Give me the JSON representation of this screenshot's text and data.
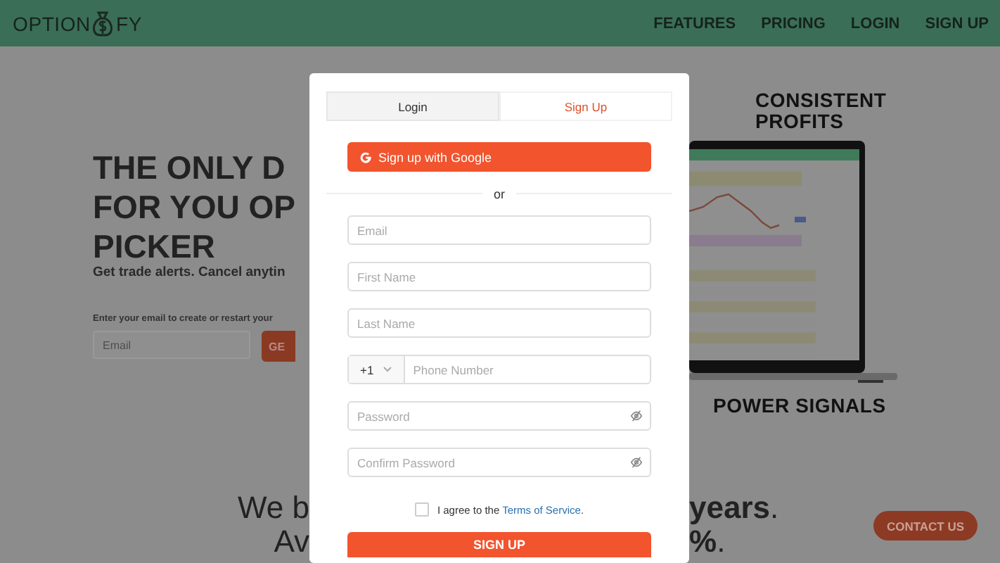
{
  "header": {
    "logo_left": "OPTION",
    "logo_right": "FY",
    "nav": [
      "FEATURES",
      "PRICING",
      "LOGIN",
      "SIGN UP"
    ]
  },
  "hero": {
    "headline": [
      "THE ONLY D",
      "FOR YOU OP",
      "PICKER"
    ],
    "subtitle": "Get trade alerts. Cancel anytin",
    "email_prompt": "Enter your email to create or restart your",
    "email_field": {
      "placeholder": "Email"
    },
    "button": "GE"
  },
  "promo": {
    "top": "CONSISTENT PROFITS",
    "bottom": "POWER SIGNALS"
  },
  "stats": [
    {
      "left": "We b",
      "right": "**years**."
    },
    {
      "left": "Av",
      "right": "**%**."
    }
  ],
  "contact_button": "CONTACT US",
  "modal": {
    "tabs": [
      {
        "label": "Login",
        "selected": false
      },
      {
        "label": "Sign Up",
        "selected": true
      }
    ],
    "google_button": "Sign up with Google",
    "divider": "or",
    "fields": [
      {
        "kind": "text",
        "placeholder": "Email"
      },
      {
        "kind": "text",
        "placeholder": "First Name"
      },
      {
        "kind": "text",
        "placeholder": "Last Name"
      },
      {
        "kind": "phone",
        "code": "+1",
        "placeholder": "Phone Number"
      },
      {
        "kind": "password",
        "placeholder": "Password"
      },
      {
        "kind": "password",
        "placeholder": "Confirm Password"
      }
    ],
    "terms": {
      "checked": false,
      "text": "I agree to the",
      "link": "Terms of Service",
      "after": "."
    },
    "submit": "SIGN UP"
  }
}
